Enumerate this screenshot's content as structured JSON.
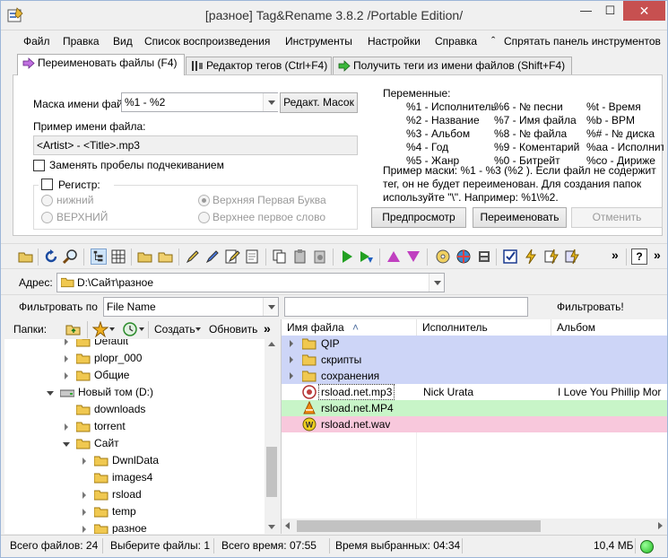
{
  "window": {
    "title": "[разное] Tag&Rename 3.8.2 /Portable Edition/",
    "minimize": "—",
    "maximize": "☐",
    "close": "✕",
    "close_color": "#c75050"
  },
  "menu": [
    "Файл",
    "Правка",
    "Вид",
    "Список воспроизведения",
    "Инструменты",
    "Настройки",
    "Справка",
    "Спрятать панель инструментов"
  ],
  "menu_hide_prefix": "ˆ",
  "tabs": [
    "Переименовать файлы (F4)",
    "Редактор тегов (Ctrl+F4)",
    "Получить теги из имени файлов (Shift+F4)"
  ],
  "rename": {
    "mask_label": "Маска имени фай",
    "mask_value": "%1 - %2",
    "edit_mask_button": "Редакт. Масок",
    "example_label": "Пример имени файла:",
    "example_value": "<Artist> - <Title>.mp3",
    "replace_spaces": "Заменять пробелы подчекиванием",
    "case_label": "Регистр:",
    "case_lower": "нижний",
    "case_upper": "ВЕРХНИЙ",
    "case_title": "Верхняя Первая Буква",
    "case_first": "Верхнее первое слово",
    "vars_title": "Переменные:",
    "vars_col1": [
      "%1 - Исполнитель",
      "%2 - Название",
      "%3 - Альбом",
      "%4 - Год",
      "%5 - Жанр"
    ],
    "vars_col2": [
      "%6 - № песни",
      "%7 - Имя файла",
      "%8 - № файла",
      "%9 - Коментарий",
      "%0 - Битрейт"
    ],
    "vars_col3": [
      "%t - Время",
      "%b - BPM",
      "%# - № диска",
      "%aa - Исполнит",
      "%co - Дириже"
    ],
    "hint_lines": [
      "Пример маски: %1 - %3 (%2 ). Если файл не содержит",
      "тег, он не будет переименован. Для создания папок",
      "используйте \"\\\". Например: %1\\%2."
    ],
    "preview_button": "Предпросмотр",
    "rename_button": "Переименовать",
    "cancel_button": "Отменить"
  },
  "toolbar": {
    "overflow1": "»",
    "overflow2": "»",
    "help": "?"
  },
  "address": {
    "label": "Адрес:",
    "value": "D:\\Сайт\\разное"
  },
  "filter": {
    "label": "Фильтровать по",
    "field_value": "File Name",
    "apply_label": "Фильтровать!"
  },
  "folders": {
    "label": "Папки:",
    "create": "Создать",
    "refresh": "Обновить",
    "more": "»"
  },
  "tree": [
    {
      "label": "Default",
      "level": 2,
      "expander": "closed"
    },
    {
      "label": "plopr_000",
      "level": 2,
      "expander": "closed"
    },
    {
      "label": "Общие",
      "level": 2,
      "expander": "closed"
    },
    {
      "label": "Новый том (D:)",
      "level": 1,
      "expander": "open",
      "drive": true
    },
    {
      "label": "downloads",
      "level": 2,
      "expander": "none"
    },
    {
      "label": "torrent",
      "level": 2,
      "expander": "closed"
    },
    {
      "label": "Сайт",
      "level": 2,
      "expander": "open"
    },
    {
      "label": "DwnlData",
      "level": 3,
      "expander": "closed"
    },
    {
      "label": "images4",
      "level": 3,
      "expander": "none"
    },
    {
      "label": "rsload",
      "level": 3,
      "expander": "closed"
    },
    {
      "label": "temp",
      "level": 3,
      "expander": "closed"
    },
    {
      "label": "разное",
      "level": 3,
      "expander": "closed"
    }
  ],
  "file_columns": [
    "Имя файла",
    "Исполнитель",
    "Альбом"
  ],
  "sort_arrow": "˄",
  "files": [
    {
      "name": "QIP",
      "type": "folder",
      "artist": "",
      "album": "",
      "bg": "#cdd5f7"
    },
    {
      "name": "скрипты",
      "type": "folder",
      "artist": "",
      "album": "",
      "bg": "#cdd5f7"
    },
    {
      "name": "сохранения",
      "type": "folder",
      "artist": "",
      "album": "",
      "bg": "#cdd5f7"
    },
    {
      "name": "rsload.net.mp3",
      "type": "mp3",
      "artist": "Nick Urata",
      "album": "I Love You Phillip Mor",
      "bg": "#ffffff"
    },
    {
      "name": "rsload.net.MP4",
      "type": "vlc",
      "artist": "",
      "album": "",
      "bg": "#c8f5c8"
    },
    {
      "name": "rsload.net.wav",
      "type": "wav",
      "artist": "",
      "album": "",
      "bg": "#f8c8dc"
    }
  ],
  "status": {
    "total_files": "Всего файлов: 24",
    "selected": "Выберите файлы: 1",
    "total_time": "Всего время: 07:55",
    "selected_time": "Время выбранных: 04:34",
    "size": "10,4 МБ",
    "indicator_color": "#22bb22"
  }
}
